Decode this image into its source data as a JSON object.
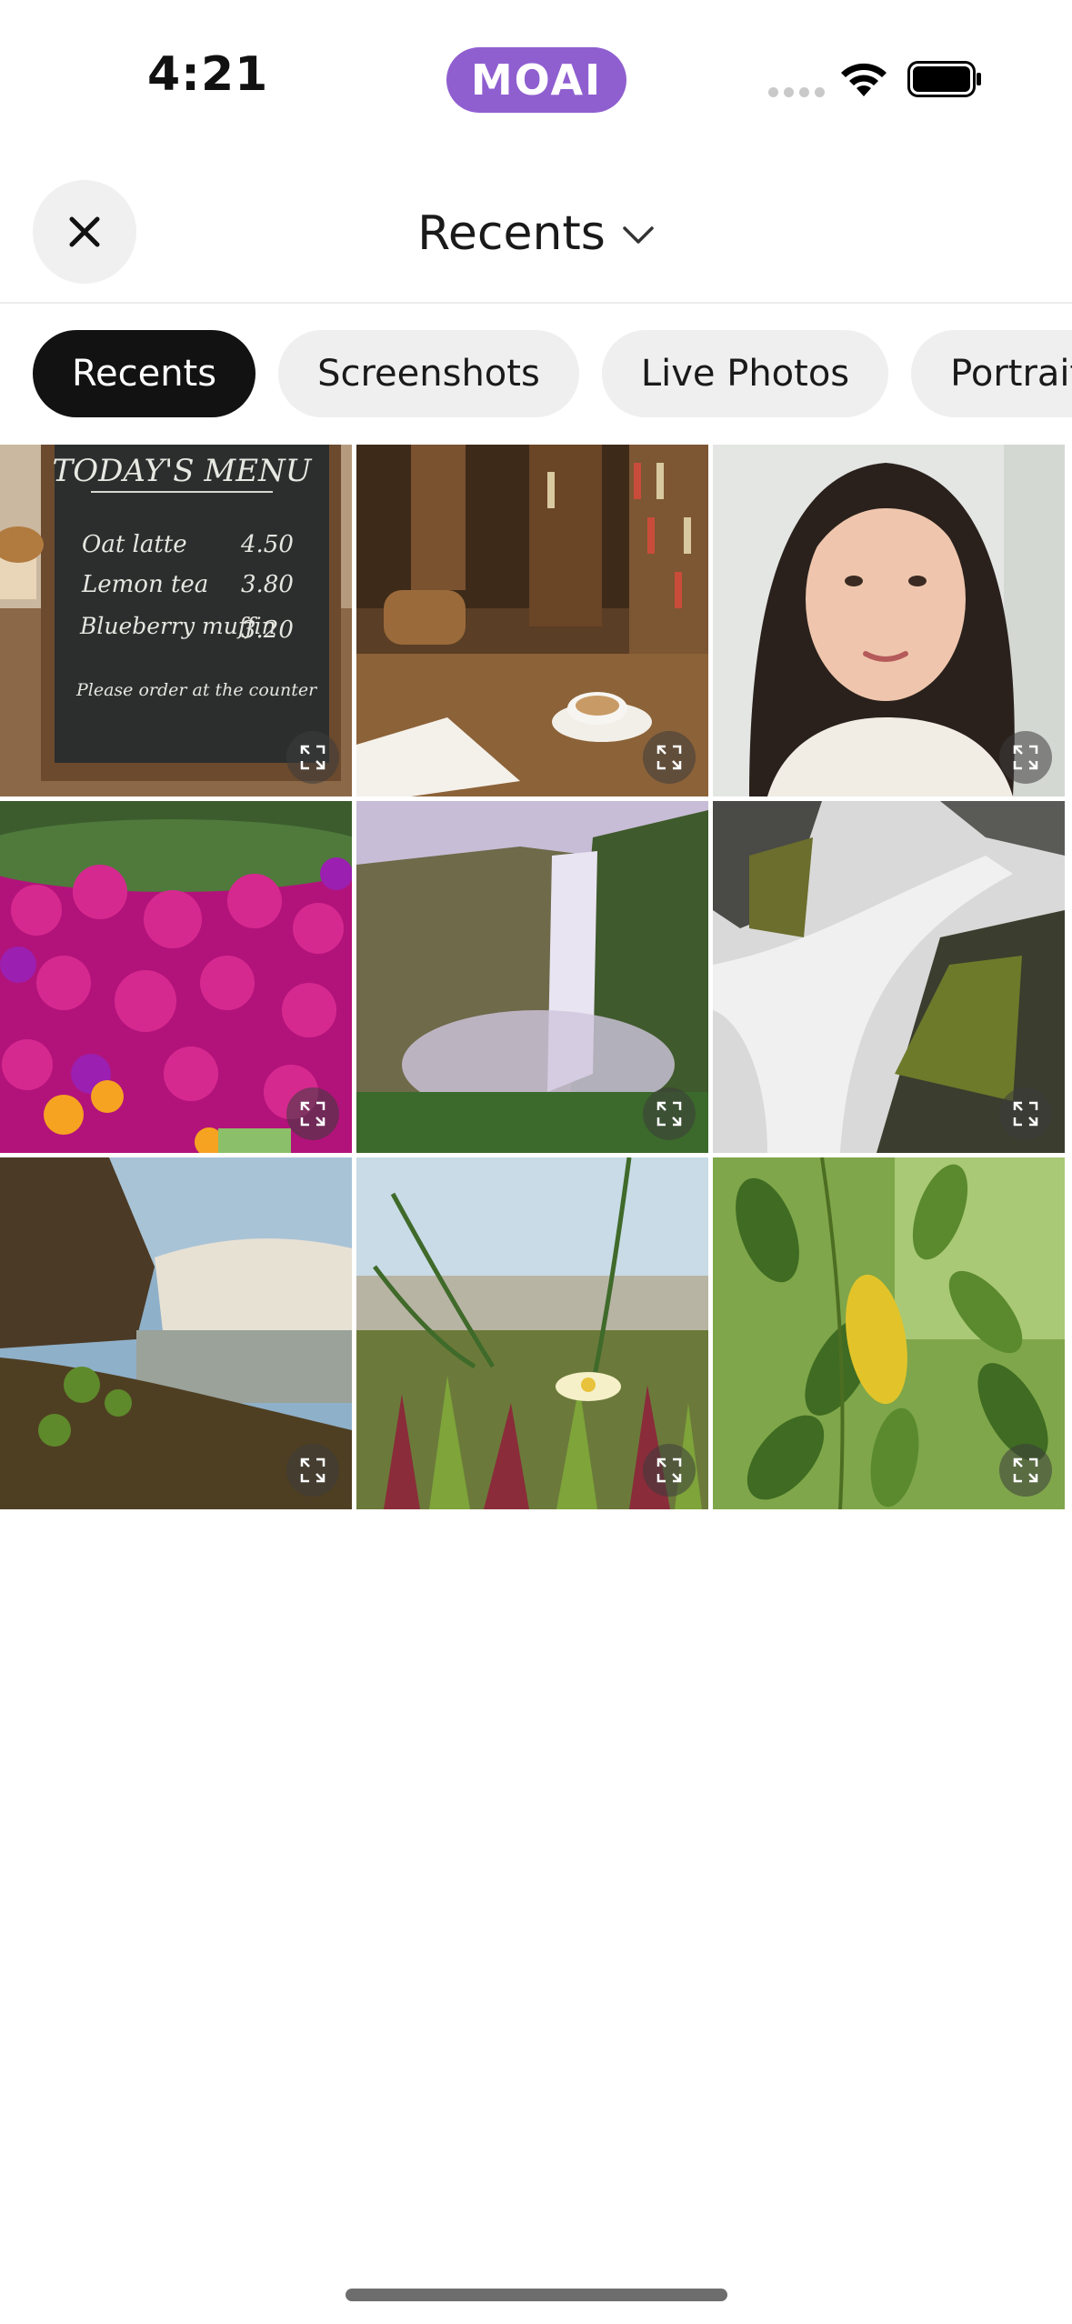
{
  "status_bar": {
    "time": "4:21",
    "app_badge": "MOAI"
  },
  "header": {
    "title": "Recents",
    "close_icon": "close-icon",
    "chevron_icon": "chevron-down-icon"
  },
  "filters": [
    {
      "label": "Recents",
      "active": true
    },
    {
      "label": "Screenshots",
      "active": false
    },
    {
      "label": "Live Photos",
      "active": false
    },
    {
      "label": "Portrait",
      "active": false
    }
  ],
  "photos": [
    {
      "subject": "chalkboard menu",
      "menu": {
        "heading": "TODAY'S MENU",
        "items": [
          {
            "name": "Oat latte",
            "price": "4.50"
          },
          {
            "name": "Lemon tea",
            "price": "3.80"
          },
          {
            "name": "Blueberry muffin",
            "price": "3.20"
          }
        ],
        "note": "Please order at the counter"
      }
    },
    {
      "subject": "bookstore cafe coffee"
    },
    {
      "subject": "portrait woman"
    },
    {
      "subject": "magenta flowers"
    },
    {
      "subject": "waterfall canyon"
    },
    {
      "subject": "waterfall rocks"
    },
    {
      "subject": "waterfall coast"
    },
    {
      "subject": "ice plant flower"
    },
    {
      "subject": "green leaves"
    }
  ],
  "colors": {
    "accent_purple": "#8f5fd0",
    "chip_active": "#121212",
    "chip_inactive": "#efefef"
  }
}
